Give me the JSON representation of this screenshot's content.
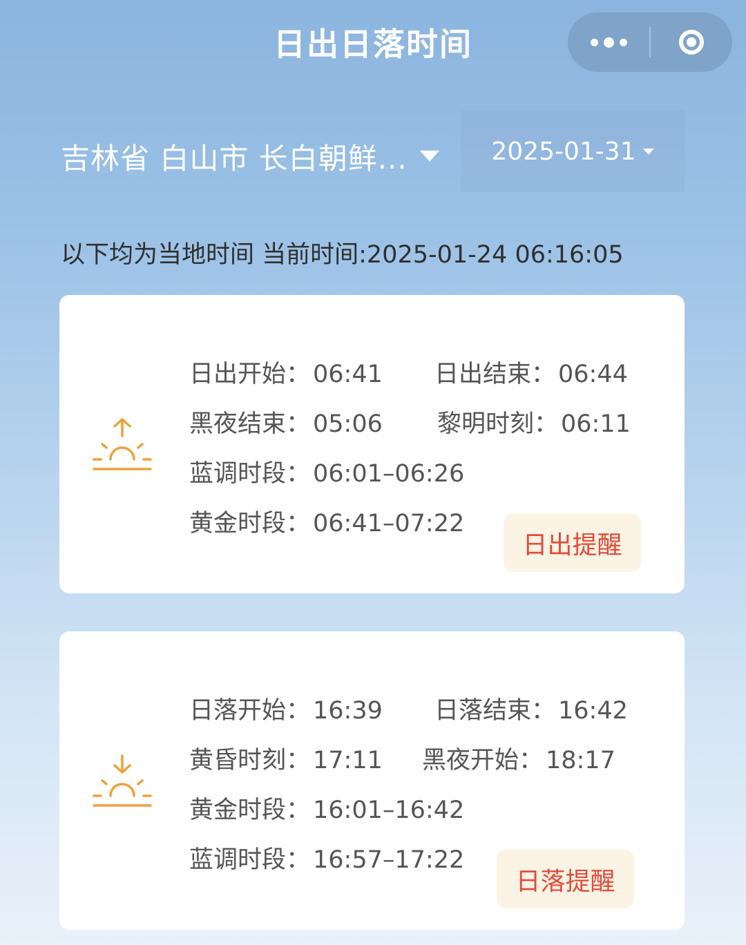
{
  "header": {
    "title": "日出日落时间",
    "more_icon": "more-dots-icon",
    "close_icon": "record-circle-icon"
  },
  "selector": {
    "location": "吉林省 白山市 长白朝鲜...",
    "date": "2025-01-31"
  },
  "note": "以下均为当地时间 当前时间:2025-01-24 06:16:05",
  "sunrise_card": {
    "icon": "sunrise-icon",
    "rows": [
      {
        "label": "日出开始：",
        "value": "06:41"
      },
      {
        "label": "日出结束：",
        "value": "06:44"
      },
      {
        "label": "黑夜结束：",
        "value": "05:06"
      },
      {
        "label": "黎明时刻：",
        "value": "06:11"
      },
      {
        "label": "蓝调时段：",
        "value": "06:01–06:26"
      },
      {
        "label": "黄金时段：",
        "value": "06:41–07:22"
      }
    ],
    "button": "日出提醒"
  },
  "sunset_card": {
    "icon": "sunset-icon",
    "rows": [
      {
        "label": "日落开始：",
        "value": "16:39"
      },
      {
        "label": "日落结束：",
        "value": "16:42"
      },
      {
        "label": "黄昏时刻：",
        "value": "17:11"
      },
      {
        "label": "黑夜开始：",
        "value": "18:17"
      },
      {
        "label": "黄金时段：",
        "value": "16:01–16:42"
      },
      {
        "label": "蓝调时段：",
        "value": "16:57–17:22"
      }
    ],
    "button": "日落提醒"
  },
  "colors": {
    "accent_orange": "#f0a03a",
    "remind_text": "#e24b3b",
    "remind_bg": "#fbf3e3"
  }
}
